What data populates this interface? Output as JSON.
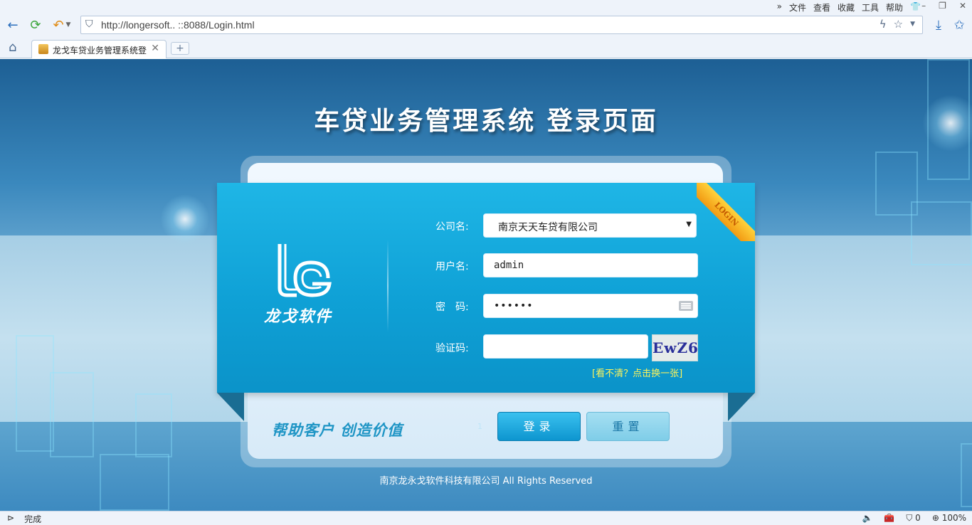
{
  "browser": {
    "menus": [
      "文件",
      "查看",
      "收藏",
      "工具",
      "帮助"
    ],
    "url": "http://longersoft..           ::8088/Login.html",
    "tab_title": "龙戈车贷业务管理系统登",
    "status": "完成",
    "zoom": "100%",
    "counter": "0"
  },
  "page": {
    "title": "车贷业务管理系统 登录页面",
    "ribbon": "LOGIN",
    "brand": "龙戈软件",
    "slogan": "帮助客户 创造价值",
    "tiny": "1",
    "copyright": "南京龙永戈软件科技有限公司 All Rights Reserved"
  },
  "form": {
    "company_label": "公司名:",
    "company_value": "南京天天车贷有限公司",
    "user_label": "用户名:",
    "user_value": "admin",
    "password_label": "密　码:",
    "password_value": "••••••",
    "captcha_label": "验证码:",
    "captcha_value": "",
    "captcha_image": "EwZ6",
    "refresh_link": "[看不清？点击换一张]",
    "login_button": "登录",
    "reset_button": "重置"
  },
  "colors": {
    "panel": "#0fa1d6",
    "accent_yellow": "#fff45a",
    "slogan": "#1f95c5"
  }
}
